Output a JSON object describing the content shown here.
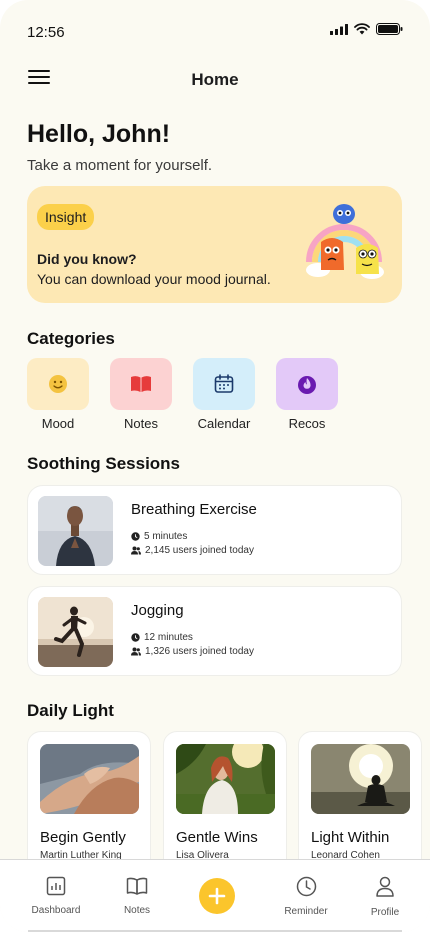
{
  "status": {
    "time": "12:56"
  },
  "header": {
    "title": "Home"
  },
  "greeting": {
    "title": "Hello, John!",
    "subtitle": "Take a moment for yourself."
  },
  "insight": {
    "tag": "Insight",
    "question": "Did you know?",
    "answer": "You can download your mood journal."
  },
  "categories": {
    "title": "Categories",
    "items": [
      {
        "label": "Mood",
        "icon": "smile-icon",
        "color": "#fdecc4"
      },
      {
        "label": "Notes",
        "icon": "book-icon",
        "color": "#fcd2d2"
      },
      {
        "label": "Calendar",
        "icon": "calendar-icon",
        "color": "#d4eefa"
      },
      {
        "label": "Recos",
        "icon": "flame-icon",
        "color": "#e3c9f8"
      }
    ]
  },
  "sessions": {
    "title": "Soothing Sessions",
    "items": [
      {
        "name": "Breathing Exercise",
        "duration": "5 minutes",
        "users": "2,145 users joined today"
      },
      {
        "name": "Jogging",
        "duration": "12 minutes",
        "users": "1,326 users joined today"
      }
    ]
  },
  "daily_light": {
    "title": "Daily Light",
    "items": [
      {
        "title": "Begin Gently",
        "author": "Martin Luther King"
      },
      {
        "title": "Gentle Wins",
        "author": "Lisa Olivera"
      },
      {
        "title": "Light Within",
        "author": "Leonard Cohen"
      }
    ]
  },
  "tabbar": {
    "dashboard": "Dashboard",
    "notes": "Notes",
    "reminder": "Reminder",
    "profile": "Profile"
  },
  "colors": {
    "accent": "#fbc52c",
    "background": "#fbfaf2",
    "insight_bg": "#fde8b4"
  }
}
